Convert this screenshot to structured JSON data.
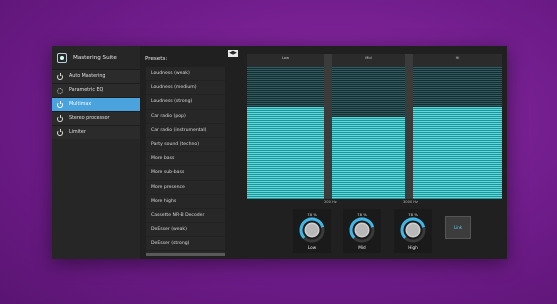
{
  "app": {
    "title": "Mastering Suite"
  },
  "sidebar": {
    "items": [
      {
        "label": "Auto Mastering",
        "icon": "power-icon",
        "active": false
      },
      {
        "label": "Parametric EQ",
        "icon": "gear-icon",
        "active": false
      },
      {
        "label": "Multimax",
        "icon": "power-icon",
        "active": true
      },
      {
        "label": "Stereo processor",
        "icon": "power-icon",
        "active": false
      },
      {
        "label": "Limiter",
        "icon": "power-icon",
        "active": false
      }
    ]
  },
  "presets": {
    "title": "Presets:",
    "items": [
      "Loudness (weak)",
      "Loudness (medium)",
      "Loudness (strong)",
      "Car radio (pop)",
      "Car radio (instrumental)",
      "Party sound (techno)",
      "More bass",
      "More sub-bass",
      "More presence",
      "More highs",
      "Cassette NR-B Decoder",
      "DeEsser (weak)",
      "DeEsser (strong)"
    ]
  },
  "toolbar": {
    "toggle_label": "◀▶"
  },
  "eq": {
    "bands": [
      {
        "label": "Low",
        "level": 0.7
      },
      {
        "label": "Mid",
        "level": 0.62
      },
      {
        "label": "Hi",
        "level": 0.7
      }
    ],
    "crossovers": [
      "200 Hz",
      "3000 Hz"
    ],
    "accent_color": "#54dfe3"
  },
  "knobs": [
    {
      "name": "Low",
      "value": "78 %",
      "fraction": 0.78
    },
    {
      "name": "Mid",
      "value": "78 %",
      "fraction": 0.78
    },
    {
      "name": "High",
      "value": "78 %",
      "fraction": 0.78
    }
  ],
  "link_button": {
    "label": "Link"
  }
}
